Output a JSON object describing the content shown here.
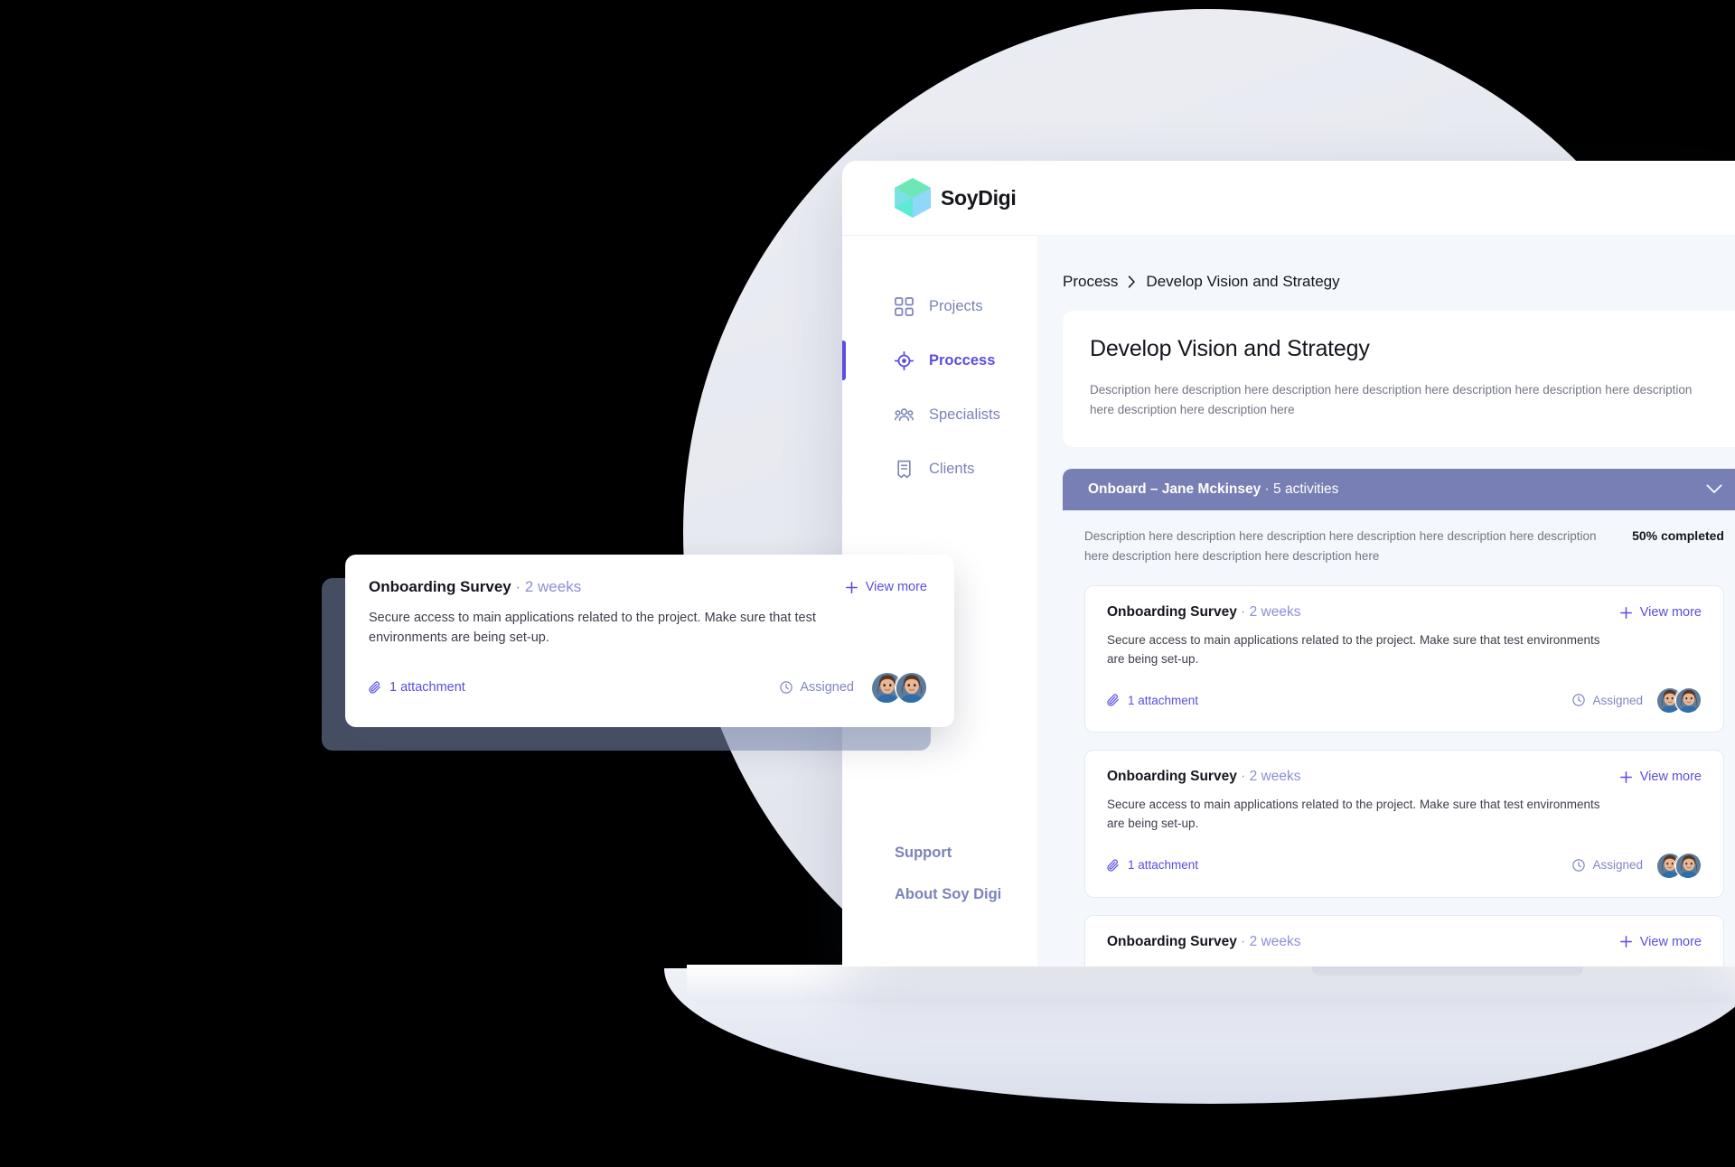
{
  "brand": {
    "name": "SoyDigi",
    "logo_icon": "soydigi-hex-cube-logo"
  },
  "colors": {
    "accent": "#5a4ee0",
    "muted_purple": "#787fb4",
    "nav_text": "#7b83b8",
    "main_bg": "#f4f7fb",
    "card_border": "#e6e9f2",
    "logo_green": "#6ee7b7",
    "logo_cyan": "#67e8f9",
    "logo_blue": "#7dd3fc"
  },
  "sidebar": {
    "items": [
      {
        "label": "Projects",
        "icon": "grid-icon",
        "active": false
      },
      {
        "label": "Proccess",
        "icon": "target-icon",
        "active": true
      },
      {
        "label": "Specialists",
        "icon": "users-icon",
        "active": false
      },
      {
        "label": "Clients",
        "icon": "document-icon",
        "active": false
      }
    ],
    "links": [
      {
        "label": "Support"
      },
      {
        "label": "About Soy Digi"
      }
    ]
  },
  "breadcrumb": {
    "root": "Process",
    "separator_icon": "chevron-right-icon",
    "current": "Develop Vision and Strategy"
  },
  "panel": {
    "title": "Develop Vision and Strategy",
    "description": "Description here description here  description here  description here  description here  description here  description here  description here  description here"
  },
  "group": {
    "title_bold": "Onboard – Jane Mckinsey",
    "title_rest": " · 5 activities",
    "collapse_icon": "chevron-down-icon",
    "description": "Description here description here  description here  description here  description here  description here  description here  description here  description here",
    "progress_label": "50% completed",
    "progress_value": 50
  },
  "activity_card": {
    "title": "Onboarding Survey",
    "duration": " · 2 weeks",
    "description": "Secure access to main applications related to the project. Make sure that test environments are being set-up.",
    "view_more_label": "View more",
    "view_more_icon": "plus-icon",
    "attachment_label": "1 attachment",
    "attachment_icon": "paperclip-icon",
    "assigned_label": "Assigned",
    "assigned_icon": "clock-icon",
    "avatar_icon": "user-avatar",
    "avatar_count": 2
  },
  "cards": [
    {
      "title": "Onboarding Survey",
      "duration": " · 2 weeks",
      "description": "Secure access to main applications related to the project. Make sure that test environments are being set-up.",
      "view_more_label": "View more",
      "attachment_label": "1 attachment",
      "assigned_label": "Assigned"
    },
    {
      "title": "Onboarding Survey",
      "duration": " · 2 weeks",
      "description": "Secure access to main applications related to the project. Make sure that test environments are being set-up.",
      "view_more_label": "View more",
      "attachment_label": "1 attachment",
      "assigned_label": "Assigned"
    },
    {
      "title": "Onboarding Survey",
      "duration": " · 2 weeks",
      "view_more_label": "View more"
    }
  ],
  "floating_card": {
    "title": "Onboarding Survey",
    "duration": " · 2 weeks",
    "description": "Secure access to main applications related to the project. Make sure that test environments are being set-up.",
    "view_more_label": "View more",
    "attachment_label": "1 attachment",
    "assigned_label": "Assigned"
  }
}
